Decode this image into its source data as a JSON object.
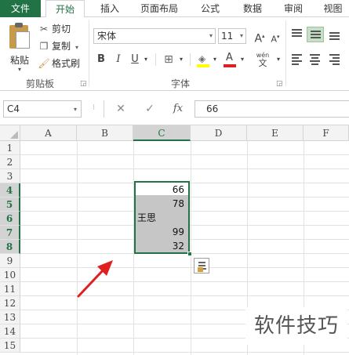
{
  "tabs": [
    "文件",
    "开始",
    "插入",
    "页面布局",
    "公式",
    "数据",
    "审阅",
    "视图"
  ],
  "active_tab": "开始",
  "clipboard": {
    "paste_label": "粘贴",
    "cut_label": "剪切",
    "copy_label": "复制",
    "format_painter_label": "格式刷",
    "group_label": "剪贴板"
  },
  "font": {
    "name": "宋体",
    "size": "11",
    "bold": "B",
    "italic": "I",
    "underline": "U",
    "grow": "A",
    "shrink": "A",
    "wen": "wén",
    "group_label": "字体"
  },
  "formula_bar": {
    "name_box": "C4",
    "cancel": "✕",
    "enter": "✓",
    "fx": "fx",
    "value": "66"
  },
  "sheet": {
    "columns": [
      "A",
      "B",
      "C",
      "D",
      "E",
      "F"
    ],
    "selected_column": "C",
    "rows": [
      "1",
      "2",
      "3",
      "4",
      "5",
      "6",
      "7",
      "8",
      "9",
      "10",
      "11",
      "12",
      "13",
      "14",
      "15"
    ],
    "selected_rows": [
      "4",
      "5",
      "6",
      "7",
      "8"
    ],
    "cells": {
      "C4": "66",
      "C5": "78",
      "C6": "王思",
      "C7": "99",
      "C8": "32"
    }
  },
  "watermark": "软件技巧",
  "colors": {
    "accent": "#217346",
    "selection": "#c6c6c6",
    "arrow": "#e02020"
  }
}
